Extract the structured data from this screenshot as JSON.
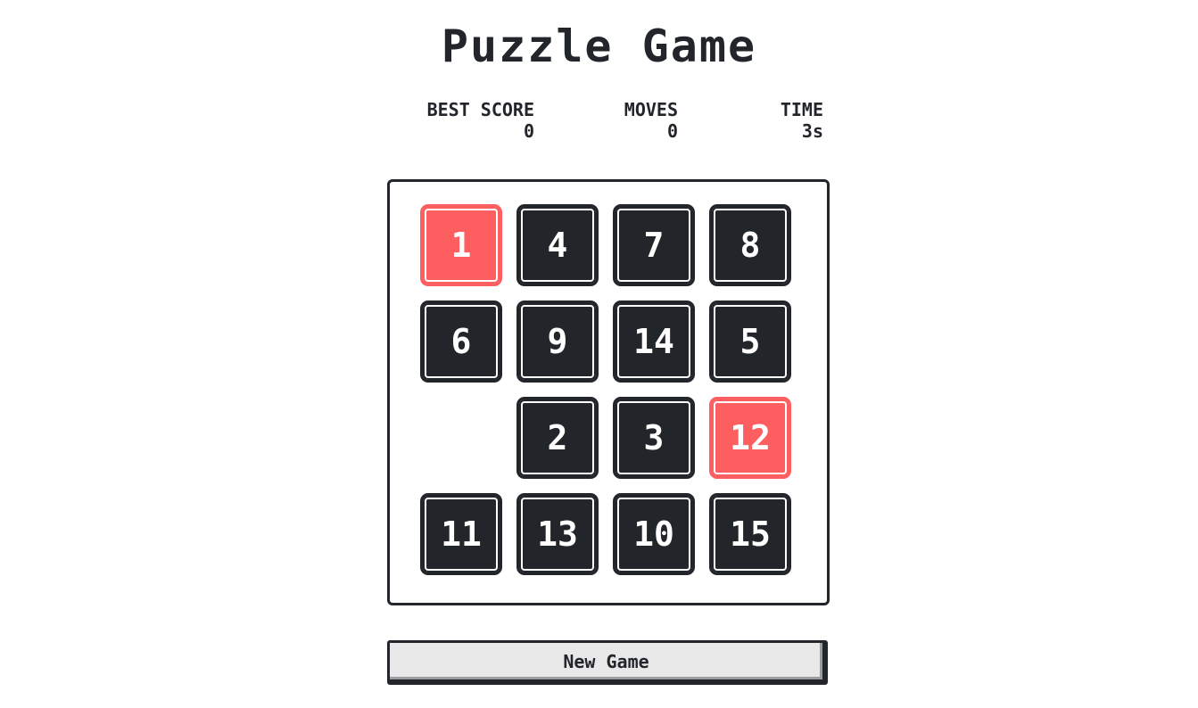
{
  "title": "Puzzle Game",
  "stats": {
    "best_score": {
      "label": "BEST SCORE",
      "value": "0"
    },
    "moves": {
      "label": "MOVES",
      "value": "0"
    },
    "time": {
      "label": "TIME",
      "value": "3s"
    }
  },
  "board": {
    "rows": 4,
    "cols": 4,
    "tiles": [
      {
        "row": 0,
        "col": 0,
        "value": "1",
        "correct": true
      },
      {
        "row": 0,
        "col": 1,
        "value": "4",
        "correct": false
      },
      {
        "row": 0,
        "col": 2,
        "value": "7",
        "correct": false
      },
      {
        "row": 0,
        "col": 3,
        "value": "8",
        "correct": false
      },
      {
        "row": 1,
        "col": 0,
        "value": "6",
        "correct": false
      },
      {
        "row": 1,
        "col": 1,
        "value": "9",
        "correct": false
      },
      {
        "row": 1,
        "col": 2,
        "value": "14",
        "correct": false
      },
      {
        "row": 1,
        "col": 3,
        "value": "5",
        "correct": false
      },
      {
        "row": 2,
        "col": 1,
        "value": "2",
        "correct": false
      },
      {
        "row": 2,
        "col": 2,
        "value": "3",
        "correct": false
      },
      {
        "row": 2,
        "col": 3,
        "value": "12",
        "correct": true
      },
      {
        "row": 3,
        "col": 0,
        "value": "11",
        "correct": false
      },
      {
        "row": 3,
        "col": 1,
        "value": "13",
        "correct": false
      },
      {
        "row": 3,
        "col": 2,
        "value": "10",
        "correct": false
      },
      {
        "row": 3,
        "col": 3,
        "value": "15",
        "correct": false
      }
    ],
    "empty": {
      "row": 2,
      "col": 0
    }
  },
  "actions": {
    "new_game_label": "New Game"
  },
  "colors": {
    "tile_dark": "#22252a",
    "tile_correct": "#fd5e60",
    "text": "#22252a",
    "button_bg": "#e8e8e8"
  }
}
